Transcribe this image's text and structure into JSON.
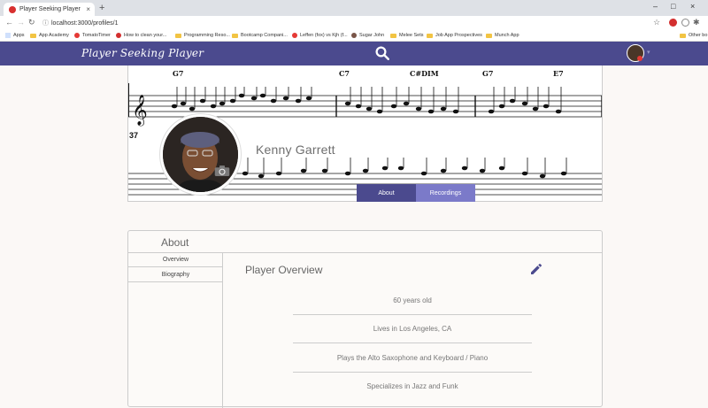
{
  "browser": {
    "tab_title": "Player Seeking Player",
    "tab_close": "×",
    "new_tab": "+",
    "url": "localhost:3000/profiles/1",
    "window_controls": [
      "–",
      "□",
      "×"
    ],
    "bookmarks": [
      {
        "label": "Apps",
        "kind": "grid"
      },
      {
        "label": "App Academy",
        "kind": "folder"
      },
      {
        "label": "TomatoTimer",
        "kind": "dot",
        "color": "#e53935"
      },
      {
        "label": "How to clean your...",
        "kind": "dot",
        "color": "#d32f2f"
      },
      {
        "label": "Programming Reso...",
        "kind": "folder"
      },
      {
        "label": "Bootcamp Compani...",
        "kind": "folder"
      },
      {
        "label": "Leffen (fox) vs Kjh (f...",
        "kind": "dot",
        "color": "#e53935"
      },
      {
        "label": "Sugar John",
        "kind": "dot",
        "color": "#795548"
      },
      {
        "label": "Melee Sets",
        "kind": "folder"
      },
      {
        "label": "Job App Prospectives",
        "kind": "folder"
      },
      {
        "label": "Munch App",
        "kind": "folder"
      },
      {
        "label": "Other bo",
        "kind": "folder"
      }
    ]
  },
  "app": {
    "logo": "Player Seeking Player",
    "accent": "#4b4a8e",
    "accent_light": "#7b7ac9",
    "caret": "▾"
  },
  "profile": {
    "name": "Kenny Garrett",
    "tabs": {
      "about": "About",
      "recordings": "Recordings"
    },
    "chords": [
      "G7",
      "C7",
      "C#DIM",
      "G7",
      "E7"
    ],
    "measure_number": "37"
  },
  "about": {
    "title": "About",
    "nav": [
      "Overview",
      "Biography"
    ],
    "overview_title": "Player Overview",
    "facts": [
      "60 years old",
      "Lives in Los Angeles, CA",
      "Plays the Alto Saxophone and Keyboard / Piano",
      "Specializes in Jazz and Funk"
    ]
  }
}
